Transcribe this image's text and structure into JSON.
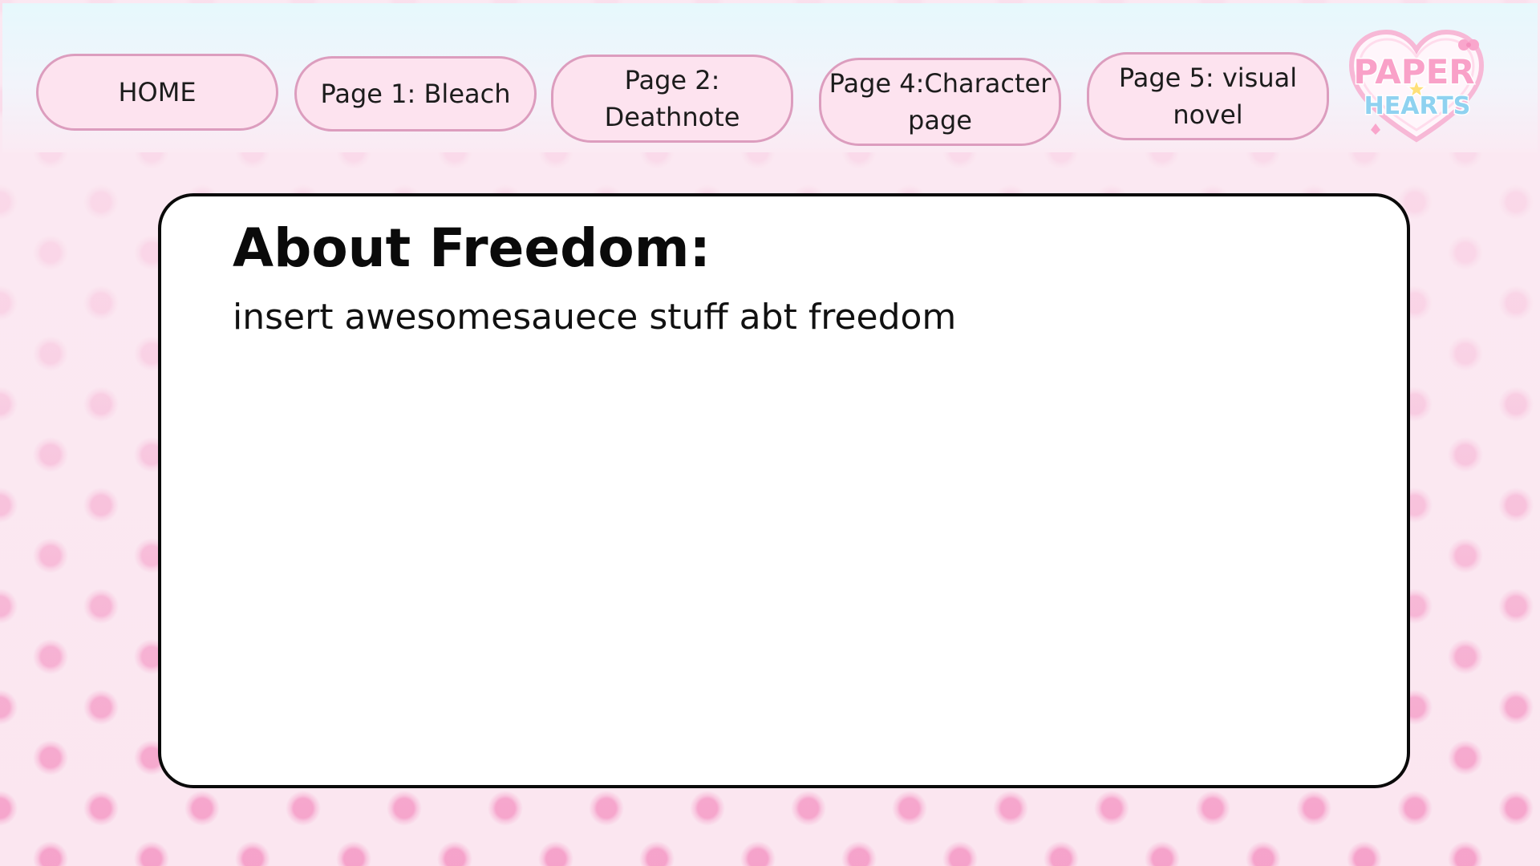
{
  "nav": {
    "items": [
      {
        "label": "HOME"
      },
      {
        "label": "Page 1: Bleach"
      },
      {
        "label": "Page 2: Deathnote"
      },
      {
        "label": "Page 4:Character page"
      },
      {
        "label": "Page 5: visual novel"
      }
    ],
    "logo_text": {
      "line1": "PAPER",
      "line2": "HEARTS"
    }
  },
  "content": {
    "title": "About Freedom:",
    "body": "insert awesomesauece stuff abt freedom"
  },
  "colors": {
    "button_fill": "#fde3ef",
    "button_border": "#dc9dbe",
    "polka_dot": "#f496c4",
    "background": "#fbe6f0",
    "nav_bar_top": "#e6f8fc"
  }
}
